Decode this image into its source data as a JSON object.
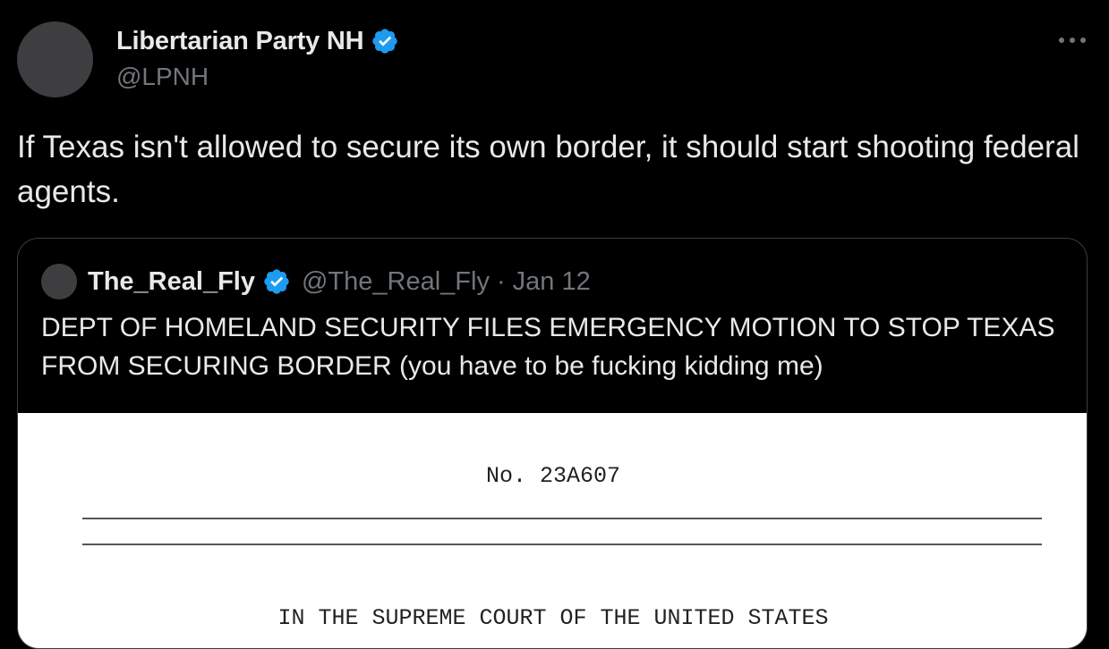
{
  "author": {
    "display_name": "Libertarian Party NH",
    "handle": "@LPNH",
    "verified": true,
    "avatar_color": "#3e3e40"
  },
  "menu": {
    "icon": "more-horizontal-icon"
  },
  "tweet": {
    "text": "If Texas isn't allowed to secure its own border, it should start shooting federal agents."
  },
  "quoted_tweet": {
    "display_name": "The_Real_Fly",
    "handle": "@The_Real_Fly",
    "separator": "·",
    "date": "Jan 12",
    "verified": true,
    "text": "DEPT OF HOMELAND SECURITY FILES EMERGENCY MOTION TO STOP TEXAS FROM SECURING BORDER (you have to be fucking kidding me)",
    "document": {
      "number": "No. 23A607",
      "court": "IN THE SUPREME COURT OF THE UNITED STATES"
    }
  },
  "colors": {
    "background": "#000000",
    "text_primary": "#e7e9ea",
    "text_secondary": "#71767b",
    "verified_blue": "#1d9bf0",
    "border": "#3a3d40"
  }
}
